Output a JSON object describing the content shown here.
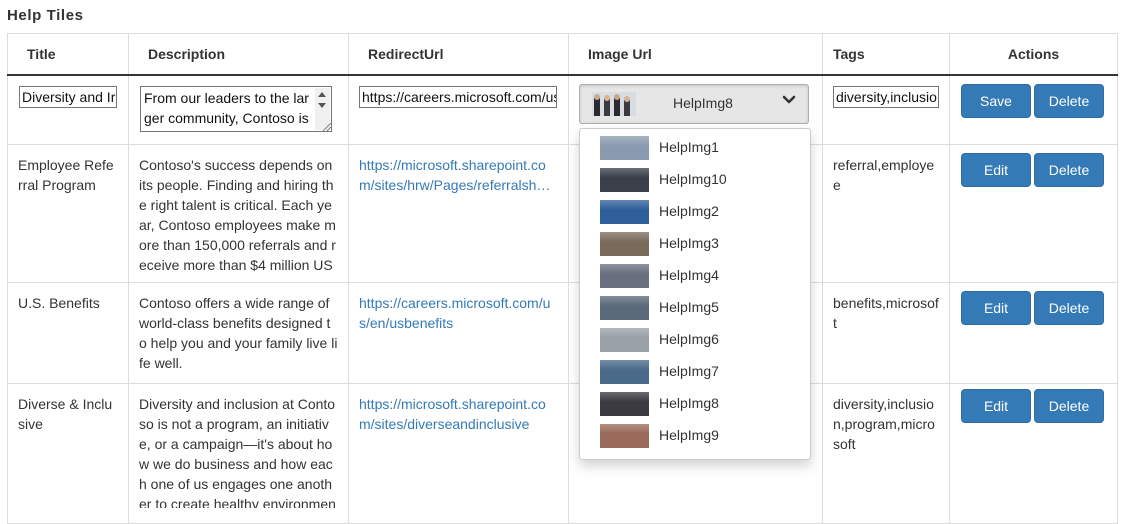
{
  "page": {
    "title": "Help Tiles"
  },
  "table": {
    "headers": {
      "title": "Title",
      "description": "Description",
      "redirect": "RedirectUrl",
      "image": "Image Url",
      "tags": "Tags",
      "actions": "Actions"
    },
    "edit_row": {
      "title_value": "Diversity and Ir",
      "description_value": "From our leaders to the larger community, Contoso is",
      "redirect_value": "https://careers.microsoft.com/us",
      "image_selected": "HelpImg8",
      "tags_value": "diversity,inclusio",
      "save_label": "Save",
      "delete_label": "Delete"
    },
    "rows": [
      {
        "title": "Employee Referral Program",
        "description": "Contoso's success depends on its people. Finding and hiring the right talent is critical. Each year, Contoso employees make more than 150,000 referrals and receive more than $4 million US",
        "redirect": "https://microsoft.sharepoint.com/sites/hrw/Pages/referralsh…",
        "tags": "referral,employee",
        "edit_label": "Edit",
        "delete_label": "Delete"
      },
      {
        "title": "U.S. Benefits",
        "description": "Contoso offers a wide range of world-class benefits designed to help you and your family live life well.",
        "redirect": "https://careers.microsoft.com/us/en/usbenefits",
        "tags": "benefits,microsoft",
        "edit_label": "Edit",
        "delete_label": "Delete"
      },
      {
        "title": "Diverse & Inclusive",
        "description": "Diversity and inclusion at Contoso is not a program, an initiative, or a campaign—it's about how we do business and how each one of us engages one another to create healthy environmen",
        "redirect": "https://microsoft.sharepoint.com/sites/diverseandinclusive",
        "tags": "diversity,inclusion,program,microsoft",
        "edit_label": "Edit",
        "delete_label": "Delete"
      }
    ]
  },
  "dropdown": {
    "options": [
      {
        "label": "HelpImg1",
        "thumb_color": "#8a9bb0"
      },
      {
        "label": "HelpImg10",
        "thumb_color": "#3a3f4a"
      },
      {
        "label": "HelpImg2",
        "thumb_color": "#2f5f9a"
      },
      {
        "label": "HelpImg3",
        "thumb_color": "#7a6a5a"
      },
      {
        "label": "HelpImg4",
        "thumb_color": "#6a6f80"
      },
      {
        "label": "HelpImg5",
        "thumb_color": "#5a6a7a"
      },
      {
        "label": "HelpImg6",
        "thumb_color": "#9aa0a8"
      },
      {
        "label": "HelpImg7",
        "thumb_color": "#4a6a8a"
      },
      {
        "label": "HelpImg8",
        "thumb_color": "#3a3a40"
      },
      {
        "label": "HelpImg9",
        "thumb_color": "#9a6a5a"
      }
    ]
  },
  "colors": {
    "primary_button": "#337ab7",
    "link": "#337ab7"
  }
}
